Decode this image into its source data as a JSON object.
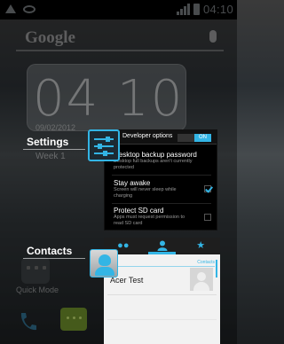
{
  "status_bar": {
    "time": "04:10"
  },
  "search_widget": {
    "label": "Google"
  },
  "clock_widget": {
    "time": "04 10",
    "date": "09/02/2012",
    "week": "Week 1"
  },
  "recent_apps": [
    {
      "label": "Settings",
      "thumbnail": {
        "header_title": "Developer options",
        "toggle_label": "ON",
        "items": [
          {
            "title": "Desktop backup password",
            "subtitle": "Desktop full backups aren't currently protected",
            "checkbox": "none"
          },
          {
            "title": "Stay awake",
            "subtitle": "Screen will never sleep while charging",
            "checkbox": "checked"
          },
          {
            "title": "Protect SD card",
            "subtitle": "Apps must request permission to read SD card",
            "checkbox": "unchecked"
          }
        ]
      }
    },
    {
      "label": "Contacts",
      "thumbnail": {
        "tab_icons": [
          "group-icon",
          "person-icon",
          "star-icon"
        ],
        "section_label": "Contacts",
        "contact_name": "Acer Test"
      }
    }
  ],
  "home_screen": {
    "quick_mode_label": "Quick Mode"
  },
  "colors": {
    "accent": "#33b5e5"
  }
}
